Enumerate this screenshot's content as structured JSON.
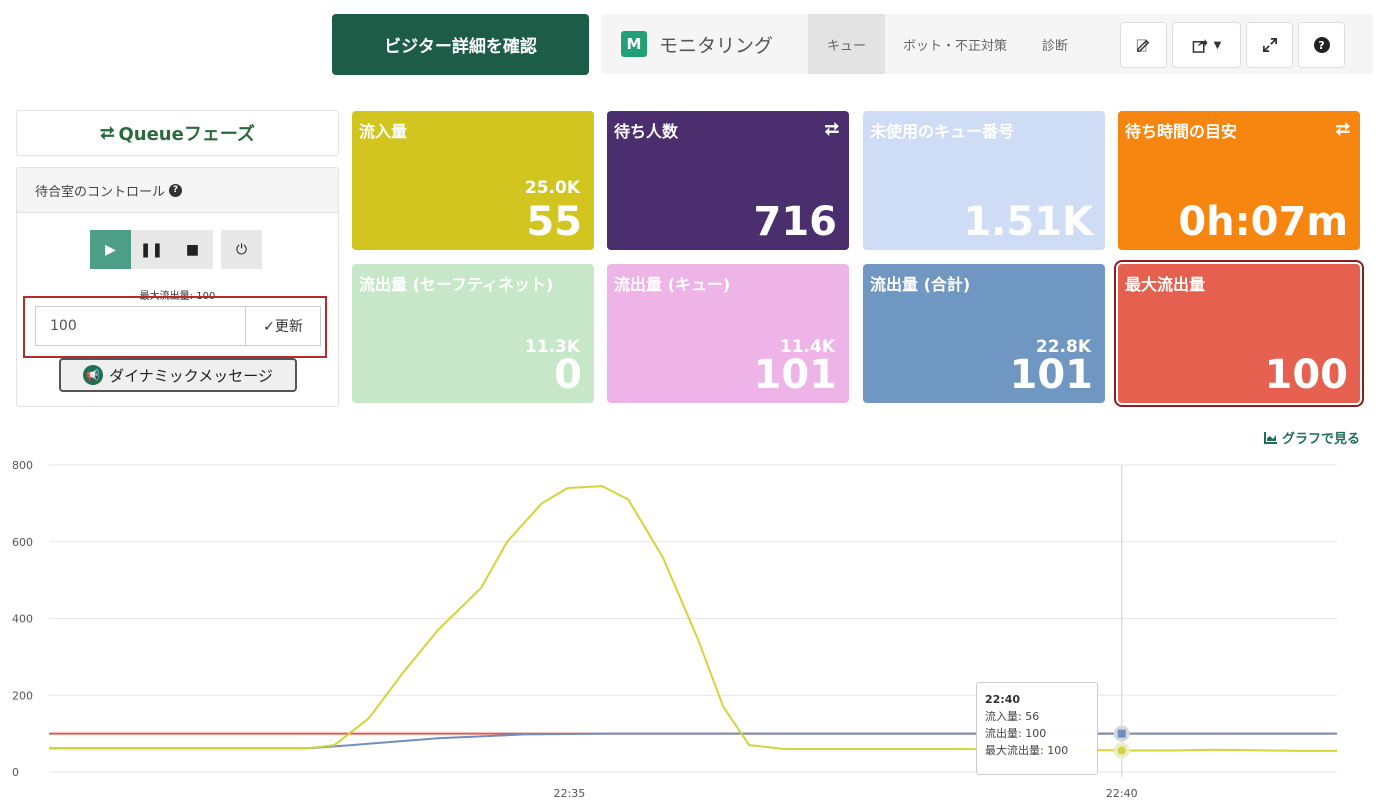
{
  "header": {
    "visitor_button": "ビジター詳細を確認",
    "brand_letter": "M",
    "brand_name": "モニタリング",
    "tabs": [
      {
        "label": "キュー",
        "active": true
      },
      {
        "label": "ボット・不正対策",
        "active": false
      },
      {
        "label": "診断",
        "active": false
      }
    ],
    "tools": [
      "edit-icon",
      "share-icon",
      "expand-icon",
      "help-icon"
    ]
  },
  "left_panel": {
    "phase_title": "Queueフェーズ",
    "control_title": "待合室のコントロール",
    "max_flow_label": "最大流出量: 100",
    "flow_input_value": "100",
    "update_button": "✓更新",
    "dynamic_message_button": "ダイナミックメッセージ"
  },
  "tiles": [
    {
      "title": "流入量",
      "sub": "25.0K",
      "main": "55",
      "color": "#d2c51f",
      "icon": ""
    },
    {
      "title": "待ち人数",
      "sub": "",
      "main": "716",
      "color": "#4b2e6e",
      "icon": "⮂"
    },
    {
      "title": "未使用のキュー番号",
      "sub": "",
      "main": "1.51K",
      "color": "#cfdcf5",
      "icon": ""
    },
    {
      "title": "待ち時間の目安",
      "sub": "",
      "main": "0h:07m",
      "color": "#f6860f",
      "icon": "⮂"
    },
    {
      "title": "流出量 (セーフティネット)",
      "sub": "11.3K",
      "main": "0",
      "color": "#c6e8c8",
      "icon": ""
    },
    {
      "title": "流出量 (キュー)",
      "sub": "11.4K",
      "main": "101",
      "color": "#eeb3e7",
      "icon": ""
    },
    {
      "title": "流出量 (合計)",
      "sub": "22.8K",
      "main": "101",
      "color": "#7097c2",
      "icon": ""
    },
    {
      "title": "最大流出量",
      "sub": "",
      "main": "100",
      "color": "#e5604f",
      "icon": ""
    }
  ],
  "graph_link": "グラフで見る",
  "tooltip": {
    "time": "22:40",
    "lines": [
      "流入量: 56",
      "流出量: 100",
      "最大流出量: 100"
    ]
  },
  "chart_data": {
    "type": "line",
    "x_ticks": [
      "22:35",
      "22:40"
    ],
    "y_ticks": [
      "0",
      "200",
      "400",
      "600",
      "800"
    ],
    "ylim": [
      0,
      800
    ],
    "grid": true,
    "series": [
      {
        "name": "流入量",
        "color": "#d4d43a",
        "points": [
          [
            22.55,
            62
          ],
          [
            22.6,
            62
          ],
          [
            22.65,
            62
          ],
          [
            22.7,
            62
          ],
          [
            22.75,
            62
          ],
          [
            22.8,
            62
          ],
          [
            22.85,
            62
          ],
          [
            22.88,
            70
          ],
          [
            22.92,
            140
          ],
          [
            22.96,
            260
          ],
          [
            23.0,
            370
          ],
          [
            23.05,
            480
          ],
          [
            23.08,
            600
          ],
          [
            23.12,
            700
          ],
          [
            23.15,
            740
          ],
          [
            23.19,
            745
          ],
          [
            23.22,
            710
          ],
          [
            23.26,
            560
          ],
          [
            23.3,
            350
          ],
          [
            23.33,
            170
          ],
          [
            23.36,
            70
          ],
          [
            23.4,
            60
          ],
          [
            23.5,
            60
          ],
          [
            23.6,
            60
          ],
          [
            23.7,
            58
          ],
          [
            23.8,
            56
          ],
          [
            23.85,
            56
          ],
          [
            23.9,
            58
          ],
          [
            24.0,
            55
          ],
          [
            24.04,
            55
          ]
        ]
      },
      {
        "name": "流出量",
        "color": "#6f8fbf",
        "points": [
          [
            22.55,
            62
          ],
          [
            22.85,
            62
          ],
          [
            22.9,
            70
          ],
          [
            23.0,
            88
          ],
          [
            23.1,
            98
          ],
          [
            23.2,
            100
          ],
          [
            24.04,
            100
          ]
        ]
      },
      {
        "name": "最大流出量",
        "color": "#e35b4d",
        "points": [
          [
            22.55,
            100
          ],
          [
            24.04,
            100
          ]
        ]
      }
    ]
  }
}
